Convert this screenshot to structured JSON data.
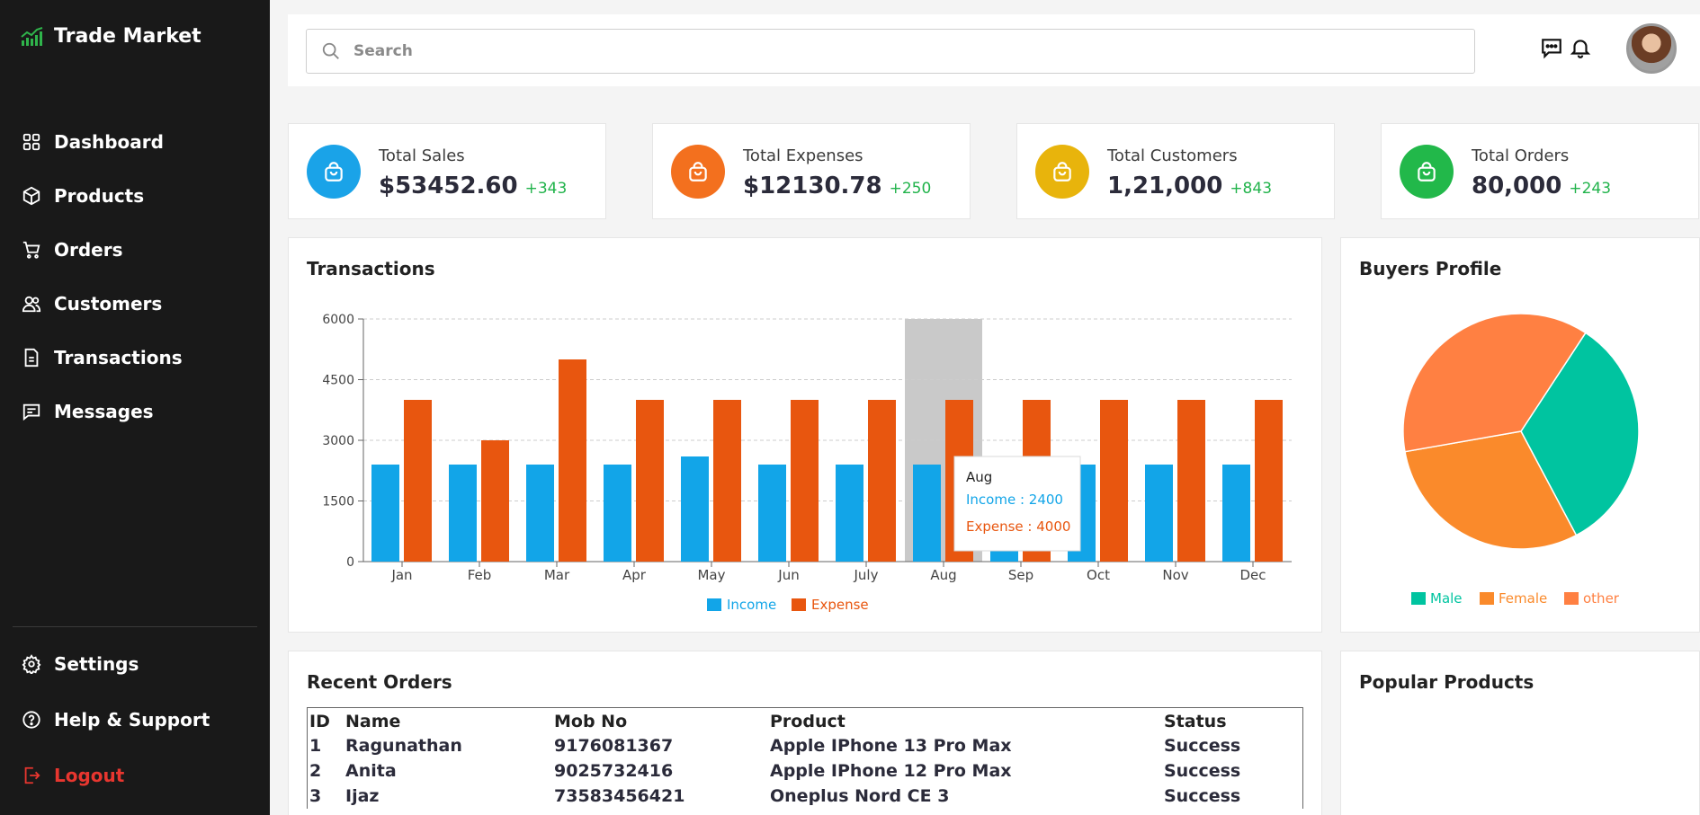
{
  "app": {
    "title": "Trade Market"
  },
  "nav": {
    "items": [
      {
        "label": "Dashboard",
        "icon": "grid-icon"
      },
      {
        "label": "Products",
        "icon": "box-icon"
      },
      {
        "label": "Orders",
        "icon": "cart-icon"
      },
      {
        "label": "Customers",
        "icon": "users-icon"
      },
      {
        "label": "Transactions",
        "icon": "document-icon"
      },
      {
        "label": "Messages",
        "icon": "message-icon"
      }
    ],
    "bottom": [
      {
        "label": "Settings",
        "icon": "gear-icon"
      },
      {
        "label": "Help & Support",
        "icon": "help-icon"
      },
      {
        "label": "Logout",
        "icon": "logout-icon"
      }
    ]
  },
  "search": {
    "placeholder": "Search",
    "value": ""
  },
  "stats": [
    {
      "label": "Total Sales",
      "value": "$53452.60",
      "delta": "+343",
      "color": "#1aa3e8"
    },
    {
      "label": "Total Expenses",
      "value": "$12130.78",
      "delta": "+250",
      "color": "#f3701e"
    },
    {
      "label": "Total Customers",
      "value": "1,21,000",
      "delta": "+843",
      "color": "#e8b40c"
    },
    {
      "label": "Total Orders",
      "value": "80,000",
      "delta": "+243",
      "color": "#22b84a"
    }
  ],
  "transactions": {
    "title": "Transactions"
  },
  "buyers": {
    "title": "Buyers Profile"
  },
  "recent_orders": {
    "title": "Recent Orders",
    "columns": [
      "ID",
      "Name",
      "Mob No",
      "Product",
      "Status"
    ],
    "rows": [
      [
        "1",
        "Ragunathan",
        "9176081367",
        "Apple IPhone 13 Pro Max",
        "Success"
      ],
      [
        "2",
        "Anita",
        "9025732416",
        "Apple IPhone 12 Pro Max",
        "Success"
      ],
      [
        "3",
        "Ijaz",
        "73583456421",
        "Oneplus Nord CE 3",
        "Success"
      ]
    ]
  },
  "popular": {
    "title": "Popular Products"
  },
  "chart_data": [
    {
      "type": "bar",
      "categories": [
        "Jan",
        "Feb",
        "Mar",
        "Apr",
        "May",
        "Jun",
        "July",
        "Aug",
        "Sep",
        "Oct",
        "Nov",
        "Dec"
      ],
      "series": [
        {
          "name": "Income",
          "color": "#12a5e8",
          "values": [
            2400,
            2400,
            2400,
            2400,
            2600,
            2400,
            2400,
            2400,
            2400,
            2400,
            2400,
            2400
          ]
        },
        {
          "name": "Expense",
          "color": "#e8560f",
          "values": [
            4000,
            3000,
            5000,
            4000,
            4000,
            4000,
            4000,
            4000,
            4000,
            4000,
            4000,
            4000
          ]
        }
      ],
      "yticks": [
        0,
        1500,
        3000,
        4500,
        6000
      ],
      "ylim": [
        0,
        6000
      ],
      "grid": true,
      "legend": "bottom",
      "highlight": "Aug",
      "tooltip": {
        "title": "Aug",
        "lines": [
          "Income : 2400",
          "Expense : 4000"
        ]
      }
    },
    {
      "type": "pie",
      "title": "Buyers Profile",
      "series": [
        {
          "name": "Male",
          "value": 33,
          "color": "#00c4a0"
        },
        {
          "name": "Female",
          "value": 30,
          "color": "#fa8a2b"
        },
        {
          "name": "other",
          "value": 37,
          "color": "#ff8042"
        }
      ],
      "legend": "bottom"
    }
  ]
}
